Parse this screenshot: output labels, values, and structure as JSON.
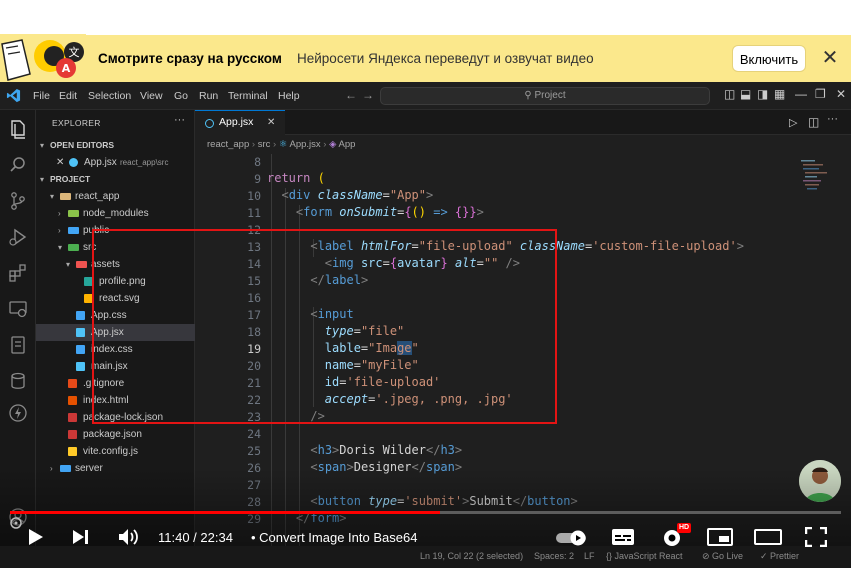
{
  "banner": {
    "title": "Смотрите сразу на русском",
    "subtitle": "Нейросети Яндекса переведут и озвучат видео",
    "button_label": "Включить",
    "close_label": "✕"
  },
  "vscode": {
    "menu": [
      "File",
      "Edit",
      "Selection",
      "View",
      "Go",
      "Run",
      "Terminal",
      "Help"
    ],
    "search_placeholder": "⚲ Project",
    "sidebar": {
      "explorer_label": "EXPLORER",
      "open_editors_label": "OPEN EDITORS",
      "open_editor_file": "App.jsx",
      "open_editor_path": "react_app\\src",
      "project_label": "PROJECT",
      "tree": [
        {
          "label": "react_app",
          "depth": 1,
          "kind": "folder-open",
          "color": "#dcb67a"
        },
        {
          "label": "node_modules",
          "depth": 2,
          "kind": "folder",
          "color": "#8bc34a"
        },
        {
          "label": "public",
          "depth": 2,
          "kind": "folder",
          "color": "#42a5f5"
        },
        {
          "label": "src",
          "depth": 2,
          "kind": "folder-open",
          "color": "#4caf50"
        },
        {
          "label": "assets",
          "depth": 3,
          "kind": "folder-open",
          "color": "#ef5350"
        },
        {
          "label": "profile.png",
          "depth": 4,
          "kind": "file",
          "color": "#26a69a"
        },
        {
          "label": "react.svg",
          "depth": 4,
          "kind": "file",
          "color": "#ffb300"
        },
        {
          "label": "App.css",
          "depth": 3,
          "kind": "file",
          "color": "#42a5f5"
        },
        {
          "label": "App.jsx",
          "depth": 3,
          "kind": "file",
          "color": "#4fc3f7"
        },
        {
          "label": "index.css",
          "depth": 3,
          "kind": "file",
          "color": "#42a5f5"
        },
        {
          "label": "main.jsx",
          "depth": 3,
          "kind": "file",
          "color": "#4fc3f7"
        },
        {
          "label": ".gitignore",
          "depth": 2,
          "kind": "file",
          "color": "#e64a19"
        },
        {
          "label": "index.html",
          "depth": 2,
          "kind": "file",
          "color": "#e65100"
        },
        {
          "label": "package-lock.json",
          "depth": 2,
          "kind": "file",
          "color": "#cb3837"
        },
        {
          "label": "package.json",
          "depth": 2,
          "kind": "file",
          "color": "#cb3837"
        },
        {
          "label": "vite.config.js",
          "depth": 2,
          "kind": "file",
          "color": "#ffca28"
        },
        {
          "label": "server",
          "depth": 1,
          "kind": "folder",
          "color": "#42a5f5"
        }
      ]
    },
    "tab_label": "App.jsx",
    "breadcrumb": [
      "react_app",
      "src",
      "App.jsx",
      "App"
    ],
    "line_numbers": [
      "8",
      "9",
      "10",
      "11",
      "12",
      "13",
      "14",
      "15",
      "16",
      "17",
      "18",
      "19",
      "20",
      "21",
      "22",
      "23",
      "24",
      "25",
      "26",
      "27",
      "28",
      "29"
    ],
    "current_line": "19",
    "status": {
      "position": "Ln 19, Col 22 (2 selected)",
      "spaces": "Spaces: 2",
      "eol": "LF",
      "language": "{} JavaScript React",
      "golive": "⊘ Go Live",
      "prettier": "✓ Prettier"
    }
  },
  "player": {
    "time": "11:40 / 22:34",
    "title": "• Convert Image Into Base64",
    "hd_badge": "HD",
    "progress": 0.517,
    "colors": {
      "progress": "#ff0000",
      "highlight_box": "#e31414"
    }
  }
}
